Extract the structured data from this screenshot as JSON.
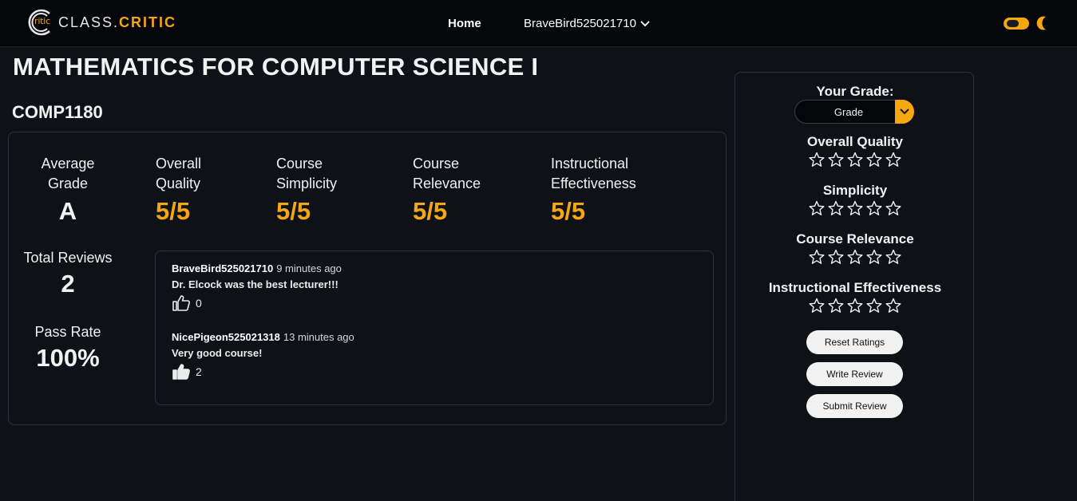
{
  "brand": {
    "mark_text": "ritic",
    "name_a": "CLASS.",
    "name_b": "CRITIC"
  },
  "nav": {
    "home": "Home",
    "user": "BraveBird525021710"
  },
  "colors": {
    "accent": "#f4a70f",
    "background": "#0f1118",
    "navbar": "#05060a"
  },
  "course": {
    "title": "MATHEMATICS FOR COMPUTER SCIENCE I",
    "code": "COMP1180"
  },
  "stats": {
    "average_grade": {
      "label_1": "Average",
      "label_2": "Grade",
      "value": "A"
    },
    "overall_quality": {
      "label_1": "Overall",
      "label_2": "Quality",
      "value": "5/5"
    },
    "course_simplicity": {
      "label_1": "Course",
      "label_2": "Simplicity",
      "value": "5/5"
    },
    "course_relevance": {
      "label_1": "Course",
      "label_2": "Relevance",
      "value": "5/5"
    },
    "instructional_effectiveness": {
      "label_1": "Instructional",
      "label_2": "Effectiveness",
      "value": "5/5"
    },
    "total_reviews": {
      "label": "Total Reviews",
      "value": "2"
    },
    "pass_rate": {
      "label": "Pass Rate",
      "value": "100%"
    }
  },
  "reviews": [
    {
      "user": "BraveBird525021710",
      "time": "9 minutes ago",
      "text": "Dr. Elcock was the best lecturer!!!",
      "likes": "0",
      "liked": false
    },
    {
      "user": "NicePigeon525021318",
      "time": "13 minutes ago",
      "text": "Very good course!",
      "likes": "2",
      "liked": true
    }
  ],
  "rating_panel": {
    "your_grade_label": "Your Grade:",
    "grade_placeholder": "Grade",
    "categories": [
      {
        "label": "Overall Quality",
        "stars": 0
      },
      {
        "label": "Simplicity",
        "stars": 0
      },
      {
        "label": "Course Relevance",
        "stars": 0
      },
      {
        "label": "Instructional Effectiveness",
        "stars": 0
      }
    ],
    "buttons": {
      "reset": "Reset Ratings",
      "write": "Write Review",
      "submit": "Submit Review"
    }
  },
  "icons": {
    "logo": "c-ring-logo",
    "user_menu": "chevron-down-icon",
    "theme_toggle": "toggle-switch",
    "theme_mode": "moon-icon",
    "like": "thumbs-up-icon",
    "rating": "star-outline-icon",
    "grade_dropdown": "chevron-down-icon"
  }
}
